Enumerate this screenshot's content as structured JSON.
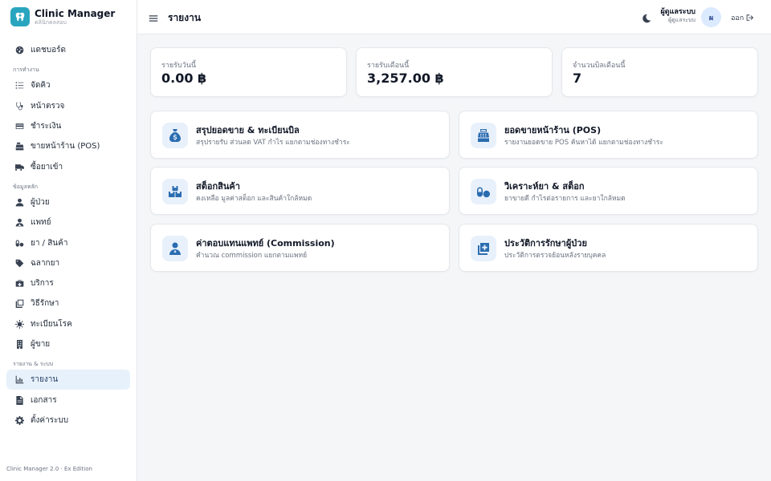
{
  "brand": {
    "title": "Clinic Manager",
    "subtitle": "คลินิกคลสอบ"
  },
  "sidebar": {
    "items": [
      {
        "label": "แดชบอร์ด",
        "icon": "dashboard-icon"
      }
    ],
    "sections": [
      {
        "title": "การทำงาน",
        "items": [
          {
            "label": "จัดคิว",
            "icon": "queue-icon"
          },
          {
            "label": "หน้าตรวจ",
            "icon": "stethoscope-icon"
          },
          {
            "label": "ชำระเงิน",
            "icon": "credit-card-icon"
          },
          {
            "label": "ขายหน้าร้าน (POS)",
            "icon": "cash-register-icon"
          },
          {
            "label": "ซื้อยาเข้า",
            "icon": "truck-icon"
          }
        ]
      },
      {
        "title": "ข้อมูลหลัก",
        "items": [
          {
            "label": "ผู้ป่วย",
            "icon": "user-icon"
          },
          {
            "label": "แพทย์",
            "icon": "doctor-icon"
          },
          {
            "label": "ยา / สินค้า",
            "icon": "pills-icon"
          },
          {
            "label": "ฉลากยา",
            "icon": "tag-icon"
          },
          {
            "label": "บริการ",
            "icon": "briefcase-medical-icon"
          },
          {
            "label": "วิธีรักษา",
            "icon": "clipboard-icon"
          },
          {
            "label": "ทะเบียนโรค",
            "icon": "virus-icon"
          },
          {
            "label": "ผู้ขาย",
            "icon": "building-icon"
          }
        ]
      },
      {
        "title": "รายงาน & ระบบ",
        "items": [
          {
            "label": "รายงาน",
            "icon": "chart-icon",
            "active": true
          },
          {
            "label": "เอกสาร",
            "icon": "document-icon"
          },
          {
            "label": "ตั้งค่าระบบ",
            "icon": "gear-icon"
          }
        ]
      }
    ],
    "footer": "Clinic Manager 2.0 · Ex Edition"
  },
  "header": {
    "title": "รายงาน",
    "user_name": "ผู้ดูแลระบบ",
    "user_role": "ผู้ดูแลระบบ",
    "avatar_initial": "ผ",
    "logout_label": "ออก"
  },
  "stats": [
    {
      "label": "รายรับวันนี้",
      "value": "0.00 ฿"
    },
    {
      "label": "รายรับเดือนนี้",
      "value": "3,257.00 ฿"
    },
    {
      "label": "จำนวนบิลเดือนนี้",
      "value": "7"
    }
  ],
  "reports": [
    {
      "title": "สรุปยอดขาย & ทะเบียนบิล",
      "desc": "สรุปรายรับ ส่วนลด VAT กำไร แยกตามช่องทางชำระ",
      "icon": "money-bag-icon"
    },
    {
      "title": "ยอดขายหน้าร้าน (POS)",
      "desc": "รายงานยอดขาย POS ค้นหาได้ แยกตามช่องทางชำระ",
      "icon": "cash-register-icon"
    },
    {
      "title": "สต็อกสินค้า",
      "desc": "คงเหลือ มูลค่าสต็อก และสินค้าใกล้หมด",
      "icon": "boxes-icon"
    },
    {
      "title": "วิเคราะห์ยา & สต็อก",
      "desc": "ยาขายดี กำไรต่อรายการ และยาใกล้หมด",
      "icon": "pills-icon"
    },
    {
      "title": "ค่าตอบแทนแพทย์ (Commission)",
      "desc": "คำนวณ commission แยกตามแพทย์",
      "icon": "doctor-icon"
    },
    {
      "title": "ประวัติการรักษาผู้ป่วย",
      "desc": "ประวัติการตรวจย้อนหลังรายบุคคล",
      "icon": "medical-record-icon"
    }
  ],
  "colors": {
    "accent": "#2aa5bf",
    "active_bg": "#e7f1fb",
    "icon_blue": "#2b6cb0"
  }
}
